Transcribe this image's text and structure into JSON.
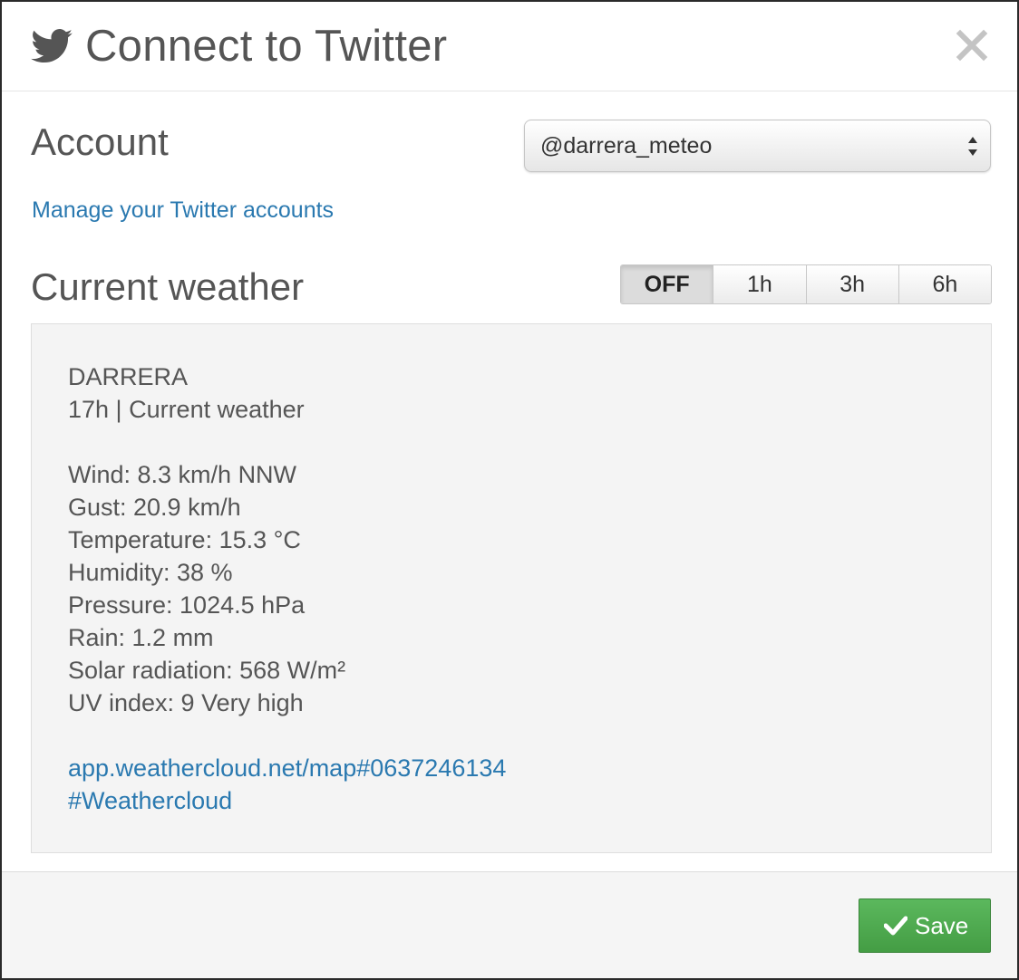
{
  "dialog": {
    "title": "Connect to Twitter",
    "icons": {
      "brand": "twitter-bird-icon",
      "close": "close-icon"
    }
  },
  "account": {
    "label": "Account",
    "selected": "@darrera_meteo",
    "manage_link": "Manage your Twitter accounts"
  },
  "weather": {
    "label": "Current weather",
    "frequency_options": [
      "OFF",
      "1h",
      "3h",
      "6h"
    ],
    "frequency_selected": "OFF",
    "preview": {
      "station": "DARRERA",
      "subtitle": "17h | Current weather",
      "lines": [
        "Wind: 8.3 km/h NNW",
        "Gust: 20.9 km/h",
        "Temperature: 15.3 °C",
        "Humidity: 38 %",
        "Pressure: 1024.5 hPa",
        "Rain: 1.2 mm",
        "Solar radiation: 568 W/m²",
        "UV index: 9 Very high"
      ],
      "link": "app.weathercloud.net/map#0637246134",
      "hashtag": "#Weathercloud"
    }
  },
  "footer": {
    "save_label": "Save",
    "save_icon": "checkmark-icon"
  },
  "colors": {
    "link": "#2a79b0",
    "save_button": "#4cae4c",
    "preview_background": "#f4f4f4",
    "text": "#555555"
  }
}
